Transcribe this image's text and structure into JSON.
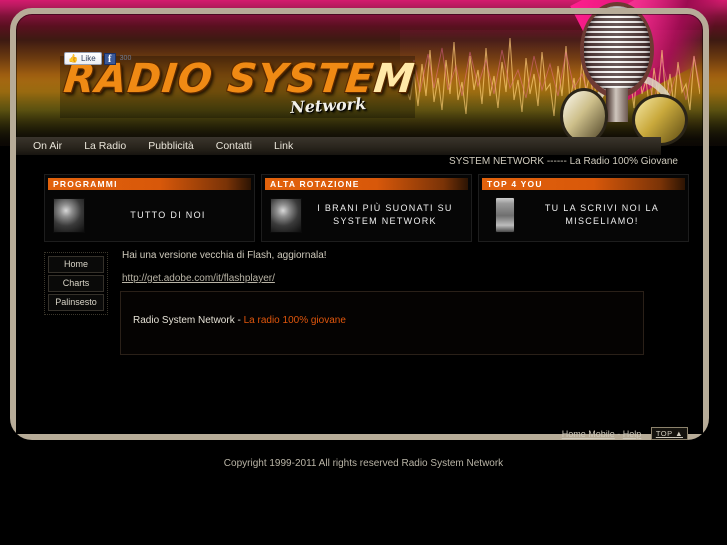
{
  "site": {
    "logo_main": "RADIO SYSTEM",
    "logo_main_bright": "M",
    "logo_sub": "Network"
  },
  "social": {
    "like_label": "Like",
    "thumb_icon": "thumbs-up-icon",
    "fb_badge": "f",
    "fb_count": "300"
  },
  "nav": {
    "items": [
      {
        "label": "On Air"
      },
      {
        "label": "La Radio"
      },
      {
        "label": "Pubblicità"
      },
      {
        "label": "Contatti"
      },
      {
        "label": "Link"
      }
    ]
  },
  "ticker": {
    "text": "SYSTEM NETWORK ------ La Radio 100% Giovane"
  },
  "features": [
    {
      "caption": "Programmi",
      "text": "Tutto di noi",
      "thumb": "programmi-thumbnail"
    },
    {
      "caption": "Alta Rotazione",
      "text": "I Brani più suonati su System Network",
      "thumb": "alta-rotazione-thumbnail"
    },
    {
      "caption": "Top 4 you",
      "text": "Tu la scrivi noi la Misceliamo!",
      "thumb": "mobile-phone-thumbnail"
    }
  ],
  "sidebar": {
    "items": [
      {
        "label": "Home"
      },
      {
        "label": "Charts"
      },
      {
        "label": "Palinsesto"
      }
    ]
  },
  "main": {
    "flash_message": "Hai una versione vecchia di Flash, aggiornala!",
    "flash_link": "http://get.adobe.com/it/flashplayer/",
    "player_text_prefix": "Radio System Network - ",
    "player_text_accent": "La radio 100% giovane"
  },
  "footer": {
    "home_mobile": "Home Mobile",
    "separator": " - ",
    "help": "Help",
    "top_button": "TOP",
    "top_icon": "chevron-up-icon",
    "copyright": "Copyright 1999-2011 All rights reserved Radio System Network"
  },
  "colors": {
    "accent_orange": "#e0560c",
    "caption_orange": "#e2620c",
    "logo_orange": "#f08a14",
    "frame_beige": "#b7ac98",
    "magenta": "#ff1e8e"
  }
}
